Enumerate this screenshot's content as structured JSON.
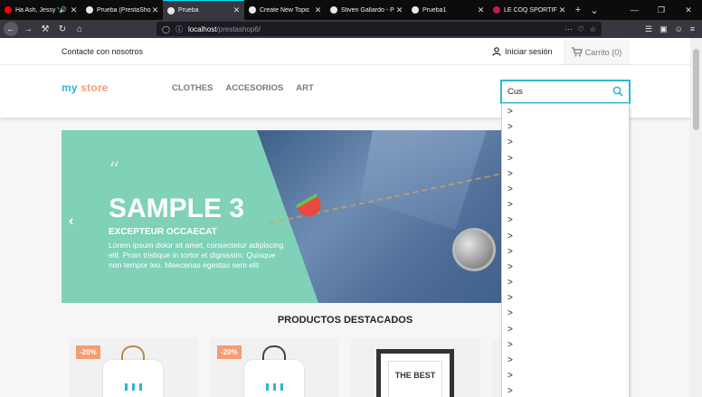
{
  "browser": {
    "tabs": [
      {
        "title": "Ha Ash, Jessy Y",
        "favicon_color": "#ff0000",
        "audio": true
      },
      {
        "title": "Prueba (PrestaShop",
        "favicon_color": "#e8e8e8"
      },
      {
        "title": "Prueba",
        "favicon_color": "#e8e8e8",
        "active": true
      },
      {
        "title": "Create New Topic",
        "favicon_color": "#e8e8e8"
      },
      {
        "title": "Stiven Gallardo - P",
        "favicon_color": "#e8e8e8"
      },
      {
        "title": "Prueba1",
        "favicon_color": "#e8e8e8"
      },
      {
        "title": "LE COQ SPORTIF",
        "favicon_color": "#c2185b"
      }
    ],
    "new_tab_icon": "plus-icon",
    "tab_list_icon": "chevron-down-icon",
    "window_controls": [
      "minimize-icon",
      "restore-icon",
      "close-icon"
    ],
    "url": {
      "host": "localhost",
      "path": "/prestashop6/"
    },
    "accent": "#00ddff"
  },
  "store": {
    "contact": "Contacte con nosotros",
    "login": "Iniciar sesión",
    "cart": "Carrito (0)",
    "logo": {
      "part1": "my",
      "part2": "store",
      "color1": "#2fb5d2",
      "color2": "#f39d72"
    },
    "menu": [
      "CLOTHES",
      "ACCESORIOS",
      "ART"
    ],
    "search": {
      "value": "Cus"
    },
    "accent": "#2fb5d2"
  },
  "slider": {
    "quote_mark": "“",
    "title": "SAMPLE 3",
    "subtitle": "EXCEPTEUR OCCAECAT",
    "description": "Lorem ipsum dolor sit amet, consectetur adipiscing elit. Proin tristique in tortor et dignissim. Quisque non tempor leo. Maecenas egestas sem elit",
    "arrow": "‹",
    "background": "#7fd1b8"
  },
  "featured": {
    "title": "PRODUCTOS DESTACADOS",
    "products": [
      {
        "badge": "-20%"
      },
      {
        "badge": "-20%"
      },
      {
        "badge": "",
        "frame_text": "THE BEST"
      }
    ]
  },
  "autocomplete": {
    "items": [
      ">",
      ">",
      ">",
      ">",
      ">",
      ">",
      ">",
      ">",
      ">",
      ">",
      ">",
      ">",
      ">",
      ">",
      ">",
      ">",
      ">",
      ">",
      ">"
    ]
  }
}
